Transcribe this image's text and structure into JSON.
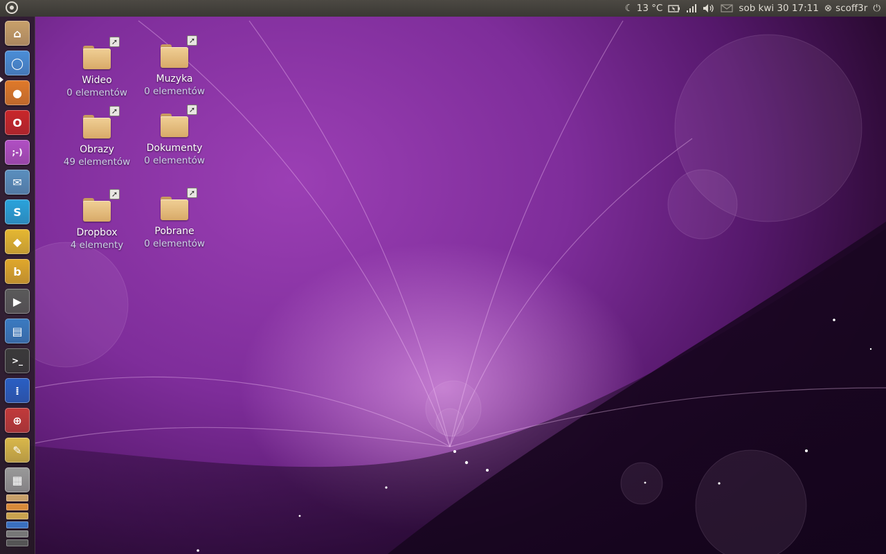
{
  "top_panel": {
    "weather": "13 °C",
    "datetime": "sob kwi 30 17:11",
    "username": "scoff3r",
    "icons": [
      "ubuntu-logo-icon",
      "moon-icon",
      "battery-icon",
      "network-signal-icon",
      "volume-icon",
      "mail-icon",
      "user-icon",
      "power-icon"
    ]
  },
  "launcher": {
    "items": [
      {
        "name": "home-folder",
        "glyph": "⌂",
        "color": "#c8a06a"
      },
      {
        "name": "chromium",
        "glyph": "◯",
        "color": "#4a8ed8"
      },
      {
        "name": "firefox",
        "glyph": "●",
        "color": "#e07a2a"
      },
      {
        "name": "opera",
        "glyph": "O",
        "color": "#c9262a"
      },
      {
        "name": "empathy",
        "glyph": ";-)",
        "color": "#b14fc4"
      },
      {
        "name": "mail-client",
        "glyph": "✉",
        "color": "#5a8fbf"
      },
      {
        "name": "skype",
        "glyph": "S",
        "color": "#2aa3dc"
      },
      {
        "name": "dropbox",
        "glyph": "◆",
        "color": "#e6b832"
      },
      {
        "name": "banshee",
        "glyph": "b",
        "color": "#e0a82c"
      },
      {
        "name": "video-player",
        "glyph": "▶",
        "color": "#5a5a5a"
      },
      {
        "name": "document-viewer",
        "glyph": "▤",
        "color": "#3a7bc2"
      },
      {
        "name": "terminal",
        "glyph": ">_",
        "color": "#3a3a3a"
      },
      {
        "name": "workspaces",
        "glyph": "⁞",
        "color": "#2a5fc4"
      },
      {
        "name": "transmission",
        "glyph": "⊕",
        "color": "#c23a3a"
      },
      {
        "name": "text-editor",
        "glyph": "✎",
        "color": "#d9b84a"
      },
      {
        "name": "calculator",
        "glyph": "▦",
        "color": "#9a9a9a"
      }
    ]
  },
  "desktop": {
    "icons": [
      {
        "label": "Wideo",
        "count": "0 elementów"
      },
      {
        "label": "Muzyka",
        "count": "0 elementów"
      },
      {
        "label": "Obrazy",
        "count": "49 elementów"
      },
      {
        "label": "Dokumenty",
        "count": "0 elementów"
      },
      {
        "label": "Dropbox",
        "count": "4 elementy"
      },
      {
        "label": "Pobrane",
        "count": "0 elementów"
      }
    ]
  },
  "colors": {
    "panel_bg": "#3e3c37",
    "panel_text": "#dfdbd2",
    "wallpaper_purple": "#8a35a8",
    "folder_tan": "#e6bf82"
  }
}
